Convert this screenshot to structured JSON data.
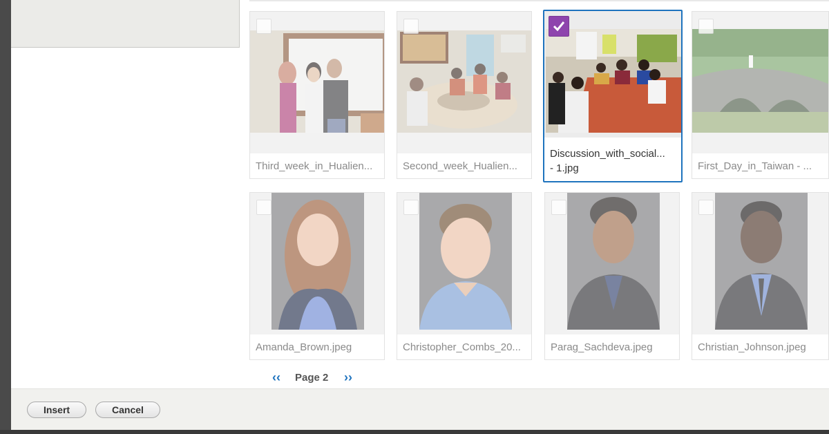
{
  "gallery": {
    "items": [
      {
        "filename": "Third_week_in_Hualien...",
        "selected": false
      },
      {
        "filename": "Second_week_Hualien...",
        "selected": false
      },
      {
        "filename_line1": "Discussion_with_social...",
        "filename_line2": "- 1.jpg",
        "selected": true
      },
      {
        "filename": "First_Day_in_Taiwan - ...",
        "selected": false
      },
      {
        "filename": "Amanda_Brown.jpeg",
        "selected": false
      },
      {
        "filename": "Christopher_Combs_20...",
        "selected": false
      },
      {
        "filename": "Parag_Sachdeva.jpeg",
        "selected": false
      },
      {
        "filename": "Christian_Johnson.jpeg",
        "selected": false
      }
    ]
  },
  "pager": {
    "prev": "‹‹",
    "label": "Page 2",
    "next": "››"
  },
  "footer": {
    "insert_label": "Insert",
    "cancel_label": "Cancel"
  },
  "colors": {
    "accent": "#1e73be",
    "check": "#8e44ad"
  }
}
